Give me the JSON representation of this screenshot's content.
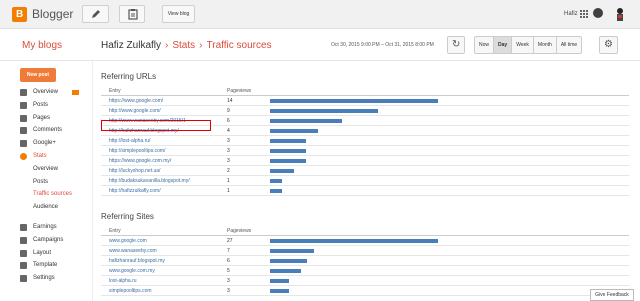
{
  "topbar": {
    "brand": "Blogger",
    "view_blog_label": "View blog",
    "user_name": "Hafiz"
  },
  "header": {
    "my_blogs": "My blogs",
    "blog_owner": "Hafiz Zulkafly",
    "crumb_stats": "Stats",
    "crumb_traffic": "Traffic sources",
    "date_range": "Oct 30, 2015 9:00 PM – Oct 31, 2015 8:00 PM",
    "range_tabs": [
      "Now",
      "Day",
      "Week",
      "Month",
      "All time"
    ],
    "active_range": "Day"
  },
  "sidebar": {
    "new_post": "New post",
    "items": [
      {
        "label": "Overview",
        "icon": "home-icon"
      },
      {
        "label": "Posts",
        "icon": "posts-icon"
      },
      {
        "label": "Pages",
        "icon": "pages-icon"
      },
      {
        "label": "Comments",
        "icon": "comments-icon"
      },
      {
        "label": "Google+",
        "icon": "google-plus-icon"
      },
      {
        "label": "Stats",
        "icon": "stats-icon"
      }
    ],
    "stats_sub": [
      "Overview",
      "Posts",
      "Traffic sources",
      "Audience"
    ],
    "items2": [
      {
        "label": "Earnings",
        "icon": "earnings-icon"
      },
      {
        "label": "Campaigns",
        "icon": "campaigns-icon"
      },
      {
        "label": "Layout",
        "icon": "layout-icon"
      },
      {
        "label": "Template",
        "icon": "template-icon"
      },
      {
        "label": "Settings",
        "icon": "settings-icon"
      }
    ]
  },
  "referring_urls": {
    "title": "Referring URLs",
    "col_entry": "Entry",
    "col_pageviews": "Pageviews",
    "max": 14,
    "rows": [
      {
        "entry": "https://www.google.com/",
        "pageviews": "14",
        "value": 14
      },
      {
        "entry": "http://www.google.com/",
        "pageviews": "9",
        "value": 9
      },
      {
        "entry": "http://www.wanaseeby.com/2015/1",
        "pageviews": "6",
        "value": 6
      },
      {
        "entry": "http://hafizhanrauf.blogspot.my/",
        "pageviews": "4",
        "value": 4
      },
      {
        "entry": "http://lost-alpha.ru/",
        "pageviews": "3",
        "value": 3
      },
      {
        "entry": "http://simplepooltips.com/",
        "pageviews": "3",
        "value": 3
      },
      {
        "entry": "https://www.google.com.my/",
        "pageviews": "3",
        "value": 3
      },
      {
        "entry": "http://luckyshop.net.ua/",
        "pageviews": "2",
        "value": 2
      },
      {
        "entry": "http://budaksukavanilla.blogspot.my/",
        "pageviews": "1",
        "value": 1
      },
      {
        "entry": "http://hafizzulkafly.com/",
        "pageviews": "1",
        "value": 1
      }
    ]
  },
  "referring_sites": {
    "title": "Referring Sites",
    "col_entry": "Entry",
    "col_pageviews": "Pageviews",
    "max": 27,
    "rows": [
      {
        "entry": "www.google.com",
        "pageviews": "27",
        "value": 27
      },
      {
        "entry": "www.wanaseeby.com",
        "pageviews": "7",
        "value": 7
      },
      {
        "entry": "hafizhanrauf.blogspot.my",
        "pageviews": "6",
        "value": 6
      },
      {
        "entry": "www.google.com.my",
        "pageviews": "5",
        "value": 5
      },
      {
        "entry": "lost-alpha.ru",
        "pageviews": "3",
        "value": 3
      },
      {
        "entry": "simplepooltips.com",
        "pageviews": "3",
        "value": 3
      }
    ]
  },
  "feedback_label": "Give Feedback",
  "colors": {
    "accent": "#dd4b39",
    "brand": "#f57d00",
    "bar": "#4a7ebb",
    "highlight": "#e00000"
  }
}
